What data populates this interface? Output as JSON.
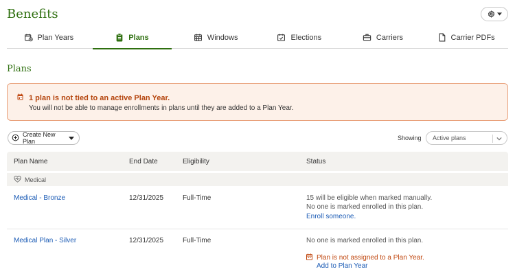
{
  "header": {
    "title": "Benefits",
    "settings_icon": "gear-icon"
  },
  "tabs": [
    {
      "label": "Plan Years",
      "icon": "calendar-clock-icon",
      "active": false
    },
    {
      "label": "Plans",
      "icon": "clipboard-icon",
      "active": true
    },
    {
      "label": "Windows",
      "icon": "calendar-grid-icon",
      "active": false
    },
    {
      "label": "Elections",
      "icon": "calendar-check-icon",
      "active": false
    },
    {
      "label": "Carriers",
      "icon": "briefcase-icon",
      "active": false
    },
    {
      "label": "Carrier PDFs",
      "icon": "document-icon",
      "active": false
    }
  ],
  "section_title": "Plans",
  "alert": {
    "title": "1 plan is not tied to an active Plan Year.",
    "body": "You will not be able to manage enrollments in plans until they are added to a Plan Year."
  },
  "toolbar": {
    "create_label": "Create New Plan",
    "showing_label": "Showing",
    "showing_value": "Active plans"
  },
  "table": {
    "columns": [
      "Plan Name",
      "End Date",
      "Eligibility",
      "Status"
    ],
    "group": "Medical",
    "rows": [
      {
        "name": "Medical - Bronze",
        "end_date": "12/31/2025",
        "eligibility": "Full-Time",
        "status_line1": "15 will be eligible when marked manually.",
        "status_line2": "No one is marked enrolled in this plan.",
        "action": "Enroll someone."
      },
      {
        "name": "Medical Plan - Silver",
        "end_date": "12/31/2025",
        "eligibility": "Full-Time",
        "status_line1": "No one is marked enrolled in this plan.",
        "warning": "Plan is not assigned to a Plan Year.",
        "action": "Add to Plan Year"
      }
    ]
  },
  "colors": {
    "brand_green": "#2e6f0f",
    "warning_orange": "#c0470f",
    "link_blue": "#1b5bb5"
  }
}
